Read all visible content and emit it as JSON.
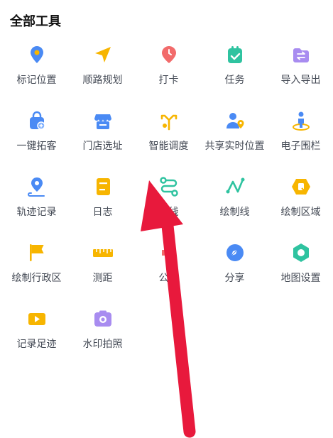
{
  "header": {
    "title": "全部工具"
  },
  "tools": [
    {
      "label": "标记位置",
      "icon": "location-pin-icon"
    },
    {
      "label": "顺路规划",
      "icon": "navigation-arrow-icon"
    },
    {
      "label": "打卡",
      "icon": "checkin-pin-icon"
    },
    {
      "label": "任务",
      "icon": "task-icon"
    },
    {
      "label": "导入导出",
      "icon": "import-export-icon"
    },
    {
      "label": "一键拓客",
      "icon": "bag-icon"
    },
    {
      "label": "门店选址",
      "icon": "store-icon"
    },
    {
      "label": "智能调度",
      "icon": "dispatch-icon"
    },
    {
      "label": "共享实时位置",
      "icon": "user-location-icon"
    },
    {
      "label": "电子围栏",
      "icon": "geofence-icon"
    },
    {
      "label": "轨迹记录",
      "icon": "track-icon"
    },
    {
      "label": "日志",
      "icon": "log-book-icon"
    },
    {
      "label": "路线",
      "icon": "route-icon"
    },
    {
      "label": "绘制线",
      "icon": "draw-line-icon"
    },
    {
      "label": "绘制区域",
      "icon": "draw-area-icon"
    },
    {
      "label": "绘制行政区",
      "icon": "flag-icon"
    },
    {
      "label": "测距",
      "icon": "ruler-icon"
    },
    {
      "label": "公告",
      "icon": "announcement-icon"
    },
    {
      "label": "分享",
      "icon": "share-icon"
    },
    {
      "label": "地图设置",
      "icon": "map-settings-icon"
    },
    {
      "label": "记录足迹",
      "icon": "video-record-icon"
    },
    {
      "label": "水印拍照",
      "icon": "camera-icon"
    }
  ],
  "colors": {
    "blue": "#4a8af4",
    "yellow": "#f7b500",
    "red": "#f26b6b",
    "green": "#2fc3a0",
    "purple": "#a88cf0",
    "arrow": "#e8193c"
  }
}
